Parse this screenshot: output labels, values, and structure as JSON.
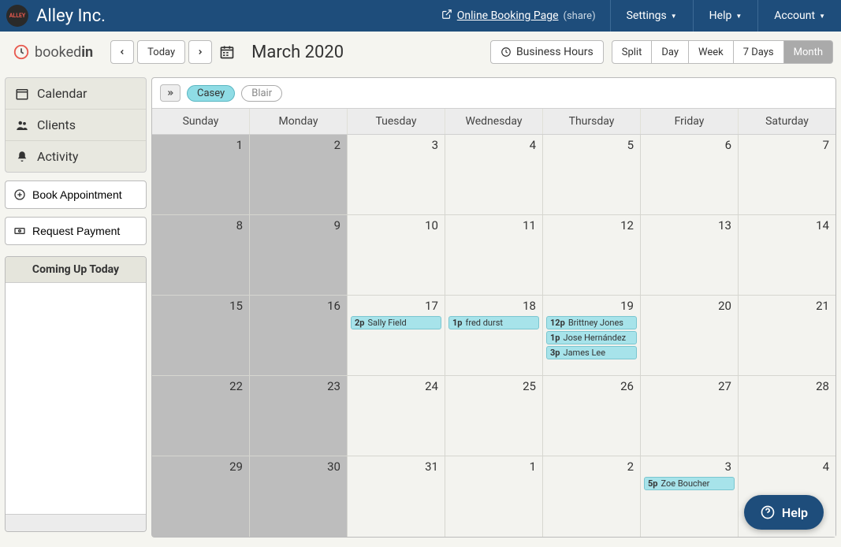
{
  "topbar": {
    "company": "Alley Inc.",
    "booking_link": "Online Booking Page",
    "share": "(share)",
    "menu": {
      "settings": "Settings",
      "help": "Help",
      "account": "Account"
    }
  },
  "subhead": {
    "brand_a": "booked",
    "brand_b": "in",
    "today": "Today",
    "title": "March 2020",
    "business_hours": "Business Hours",
    "views": {
      "split": "Split",
      "day": "Day",
      "week": "Week",
      "days7": "7 Days",
      "month": "Month"
    }
  },
  "sidebar": {
    "calendar": "Calendar",
    "clients": "Clients",
    "activity": "Activity",
    "book": "Book Appointment",
    "request": "Request Payment",
    "coming_up": "Coming Up Today"
  },
  "filters": {
    "casey": "Casey",
    "blair": "Blair"
  },
  "dow": {
    "sun": "Sunday",
    "mon": "Monday",
    "tue": "Tuesday",
    "wed": "Wednesday",
    "thu": "Thursday",
    "fri": "Friday",
    "sat": "Saturday"
  },
  "days": {
    "r0": [
      "1",
      "2",
      "3",
      "4",
      "5",
      "6",
      "7"
    ],
    "r1": [
      "8",
      "9",
      "10",
      "11",
      "12",
      "13",
      "14"
    ],
    "r2": [
      "15",
      "16",
      "17",
      "18",
      "19",
      "20",
      "21"
    ],
    "r3": [
      "22",
      "23",
      "24",
      "25",
      "26",
      "27",
      "28"
    ],
    "r4": [
      "29",
      "30",
      "31",
      "1",
      "2",
      "3",
      "4"
    ]
  },
  "events": {
    "d17": [
      {
        "t": "2p",
        "n": "Sally Field"
      }
    ],
    "d18": [
      {
        "t": "1p",
        "n": "fred durst"
      }
    ],
    "d19": [
      {
        "t": "12p",
        "n": "Brittney Jones"
      },
      {
        "t": "1p",
        "n": "Jose Hernández"
      },
      {
        "t": "3p",
        "n": "James Lee"
      }
    ],
    "apr3": [
      {
        "t": "5p",
        "n": "Zoe Boucher"
      }
    ]
  },
  "help_pill": "Help"
}
